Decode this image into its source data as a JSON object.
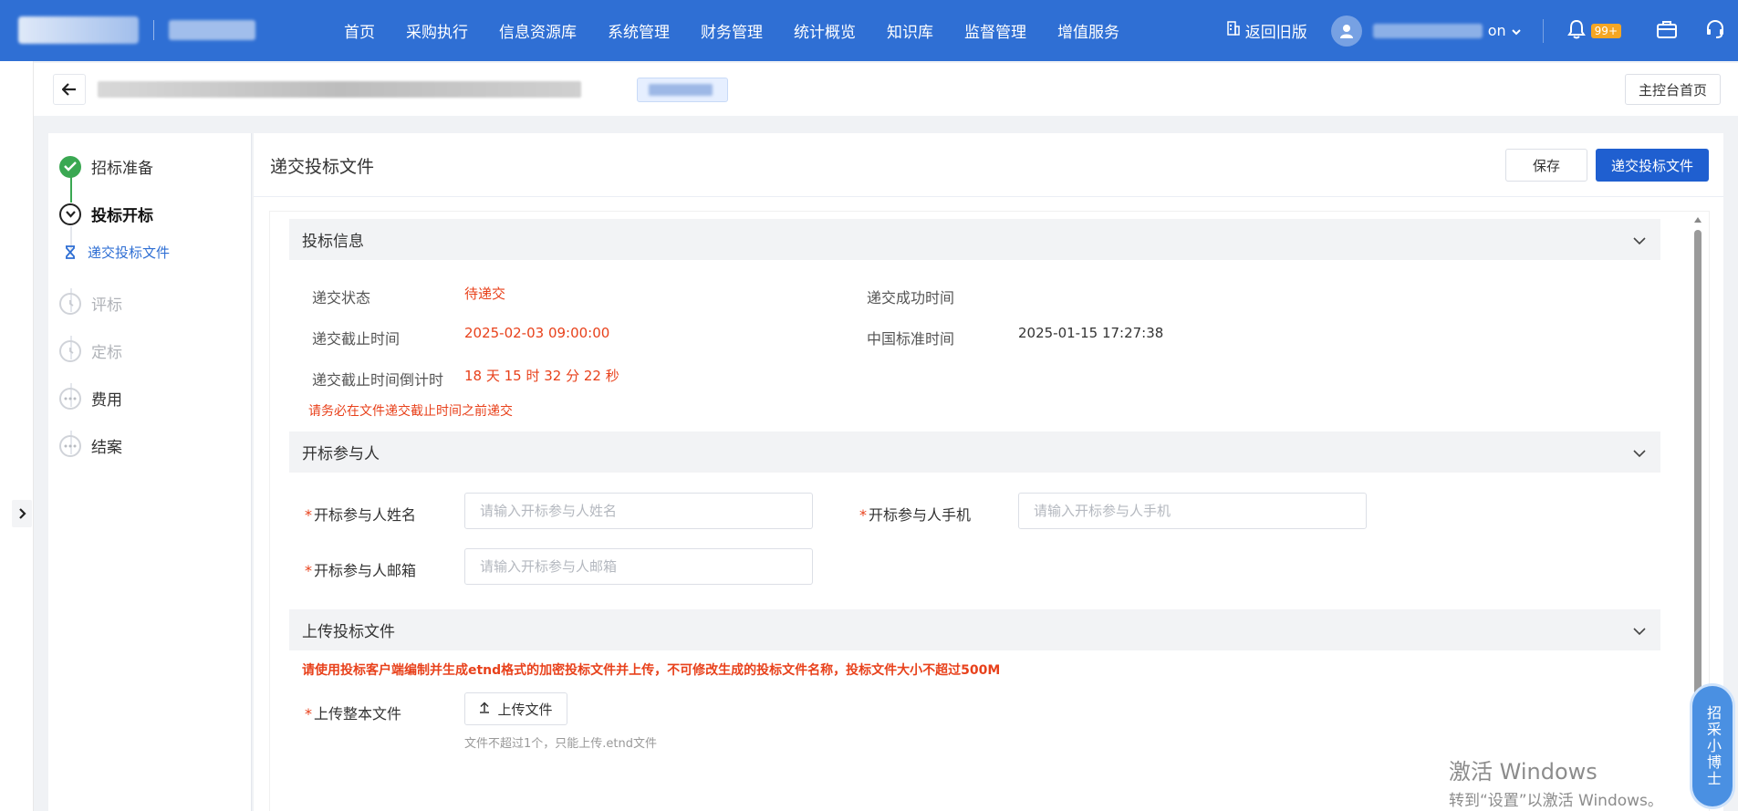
{
  "nav": {
    "items": [
      "首页",
      "采购执行",
      "信息资源库",
      "系统管理",
      "财务管理",
      "统计概览",
      "知识库",
      "监督管理",
      "增值服务"
    ],
    "old_version": "返回旧版",
    "user_suffix": "on",
    "badge": "99+"
  },
  "crumb": {
    "home_button": "主控台首页"
  },
  "steps": {
    "items": [
      {
        "label": "招标准备",
        "state": "done"
      },
      {
        "label": "投标开标",
        "state": "current"
      },
      {
        "label": "递交投标文件",
        "state": "sub-active"
      },
      {
        "label": "评标",
        "state": "pending"
      },
      {
        "label": "定标",
        "state": "pending"
      },
      {
        "label": "费用",
        "state": "more"
      },
      {
        "label": "结案",
        "state": "more"
      }
    ]
  },
  "main": {
    "title": "递交投标文件",
    "save": "保存",
    "submit": "递交投标文件"
  },
  "bid_info": {
    "title": "投标信息",
    "status_label": "递交状态",
    "status_value": "待递交",
    "success_time_label": "递交成功时间",
    "deadline_label": "递交截止时间",
    "deadline_value": "2025-02-03 09:00:00",
    "cn_time_label": "中国标准时间",
    "cn_time_value": "2025-01-15 17:27:38",
    "countdown_label": "递交截止时间倒计时",
    "countdown_value": "18 天 15 时 32 分 22 秒",
    "warning": "请务必在文件递交截止时间之前递交"
  },
  "participant": {
    "title": "开标参与人",
    "name_label": "开标参与人姓名",
    "name_placeholder": "请输入开标参与人姓名",
    "phone_label": "开标参与人手机",
    "phone_placeholder": "请输入开标参与人手机",
    "email_label": "开标参与人邮箱",
    "email_placeholder": "请输入开标参与人邮箱"
  },
  "upload": {
    "title": "上传投标文件",
    "notice": "请使用投标客户端编制并生成etnd格式的加密投标文件并上传，不可修改生成的投标文件名称，投标文件大小不超过500M",
    "file_label": "上传整本文件",
    "button": "上传文件",
    "hint": "文件不超过1个，只能上传.etnd文件"
  },
  "assistant": "招采小博士",
  "watermark": {
    "line1": "激活 Windows",
    "line2": "转到“设置”以激活 Windows。"
  },
  "colors": {
    "primary": "#2f6fd4",
    "button_primary": "#1f5fd0",
    "success": "#3aa852",
    "danger": "#e8411b",
    "badge": "#f5a623"
  }
}
